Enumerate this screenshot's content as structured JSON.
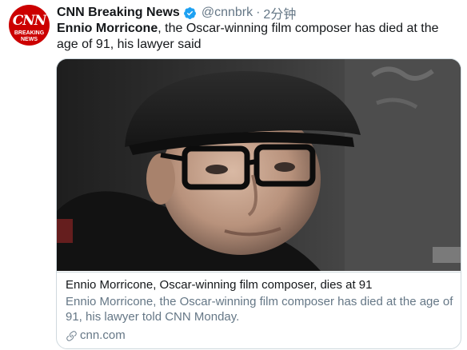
{
  "avatar": {
    "logo_text": "CNN",
    "sub_line1": "BREAKING",
    "sub_line2": "NEWS"
  },
  "header": {
    "display_name": "CNN Breaking News",
    "handle": "@cnnbrk",
    "separator": "·",
    "time": "2分钟"
  },
  "tweet": {
    "bold_name": "Ennio Morricone",
    "text_rest": ", the Oscar-winning film composer has died at the age of 91, his lawyer said"
  },
  "card": {
    "title": "Ennio Morricone, Oscar-winning film composer, dies at 91",
    "description": "Ennio Morricone, the Oscar-winning film composer has died at the age of 91, his lawyer told CNN Monday.",
    "domain": "cnn.com"
  },
  "colors": {
    "cnn_red": "#cc0000",
    "verified_blue": "#1da1f2",
    "muted_text": "#657786",
    "border": "#cfd9de"
  },
  "icons": {
    "verified": "verified-badge-icon",
    "link": "link-icon"
  }
}
